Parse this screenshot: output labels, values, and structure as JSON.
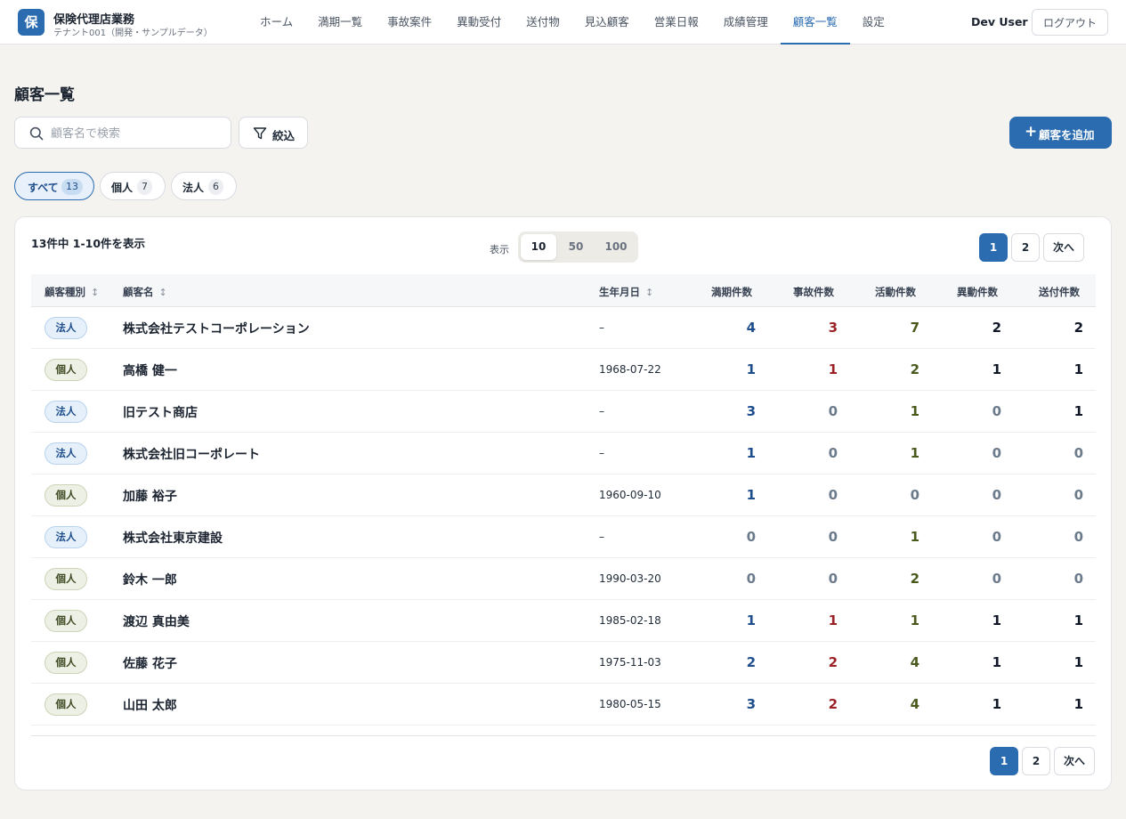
{
  "app": {
    "logo": "保",
    "name": "保険代理店業務",
    "tenant": "テナント001（開発・サンプルデータ）"
  },
  "nav": [
    {
      "label": "ホーム",
      "active": false
    },
    {
      "label": "満期一覧",
      "active": false
    },
    {
      "label": "事故案件",
      "active": false
    },
    {
      "label": "異動受付",
      "active": false
    },
    {
      "label": "送付物",
      "active": false
    },
    {
      "label": "見込顧客",
      "active": false
    },
    {
      "label": "営業日報",
      "active": false
    },
    {
      "label": "成績管理",
      "active": false
    },
    {
      "label": "顧客一覧",
      "active": true
    },
    {
      "label": "設定",
      "active": false
    }
  ],
  "user": {
    "name": "Dev User",
    "logout_label": "ログアウト"
  },
  "page": {
    "title": "顧客一覧"
  },
  "search": {
    "placeholder": "顧客名で検索",
    "value": "",
    "icon": "search-icon"
  },
  "filter": {
    "label": "絞込",
    "icon": "filter-icon"
  },
  "add_button": {
    "plus": "+",
    "label": "顧客を追加"
  },
  "chips": [
    {
      "label": "すべて",
      "count": "13",
      "active": true
    },
    {
      "label": "個人",
      "count": "7",
      "active": false
    },
    {
      "label": "法人",
      "count": "6",
      "active": false
    }
  ],
  "list": {
    "summary": "13件中 1-10件を表示",
    "page_size_label": "表示",
    "page_sizes": [
      {
        "label": "10",
        "active": true
      },
      {
        "label": "50",
        "active": false
      },
      {
        "label": "100",
        "active": false
      }
    ],
    "pagination": {
      "pages": [
        "1",
        "2"
      ],
      "current": "1",
      "next_label": "次へ"
    },
    "columns": {
      "type": "顧客種別",
      "name": "顧客名",
      "birth": "生年月日",
      "maturity": "満期件数",
      "accident": "事故件数",
      "activity": "活動件数",
      "change": "異動件数",
      "send": "送付件数",
      "sort_glyph": "↕"
    },
    "rows": [
      {
        "type": "法人",
        "kind": "corp",
        "name": "株式会社テストコーポレーション",
        "birth": "–",
        "maturity": "4",
        "accident": "3",
        "activity": "7",
        "change": "2",
        "send": "2"
      },
      {
        "type": "個人",
        "kind": "ind",
        "name": "高橋 健一",
        "birth": "1968-07-22",
        "maturity": "1",
        "accident": "1",
        "activity": "2",
        "change": "1",
        "send": "1"
      },
      {
        "type": "法人",
        "kind": "corp",
        "name": "旧テスト商店",
        "birth": "–",
        "maturity": "3",
        "accident": "0",
        "activity": "1",
        "change": "0",
        "send": "1"
      },
      {
        "type": "法人",
        "kind": "corp",
        "name": "株式会社旧コーポレート",
        "birth": "–",
        "maturity": "1",
        "accident": "0",
        "activity": "1",
        "change": "0",
        "send": "0"
      },
      {
        "type": "個人",
        "kind": "ind",
        "name": "加藤 裕子",
        "birth": "1960-09-10",
        "maturity": "1",
        "accident": "0",
        "activity": "0",
        "change": "0",
        "send": "0"
      },
      {
        "type": "法人",
        "kind": "corp",
        "name": "株式会社東京建設",
        "birth": "–",
        "maturity": "0",
        "accident": "0",
        "activity": "1",
        "change": "0",
        "send": "0"
      },
      {
        "type": "個人",
        "kind": "ind",
        "name": "鈴木 一郎",
        "birth": "1990-03-20",
        "maturity": "0",
        "accident": "0",
        "activity": "2",
        "change": "0",
        "send": "0"
      },
      {
        "type": "個人",
        "kind": "ind",
        "name": "渡辺 真由美",
        "birth": "1985-02-18",
        "maturity": "1",
        "accident": "1",
        "activity": "1",
        "change": "1",
        "send": "1"
      },
      {
        "type": "個人",
        "kind": "ind",
        "name": "佐藤 花子",
        "birth": "1975-11-03",
        "maturity": "2",
        "accident": "2",
        "activity": "4",
        "change": "1",
        "send": "1"
      },
      {
        "type": "個人",
        "kind": "ind",
        "name": "山田 太郎",
        "birth": "1980-05-15",
        "maturity": "3",
        "accident": "2",
        "activity": "4",
        "change": "1",
        "send": "1"
      }
    ]
  },
  "colors": {
    "primary": "#2b6cb0",
    "maturity": "#1e4e8c",
    "accident": "#9b2226",
    "activity": "#4a5a1c",
    "change": "#111827",
    "send": "#111827",
    "zero": "#6b7b8c"
  }
}
